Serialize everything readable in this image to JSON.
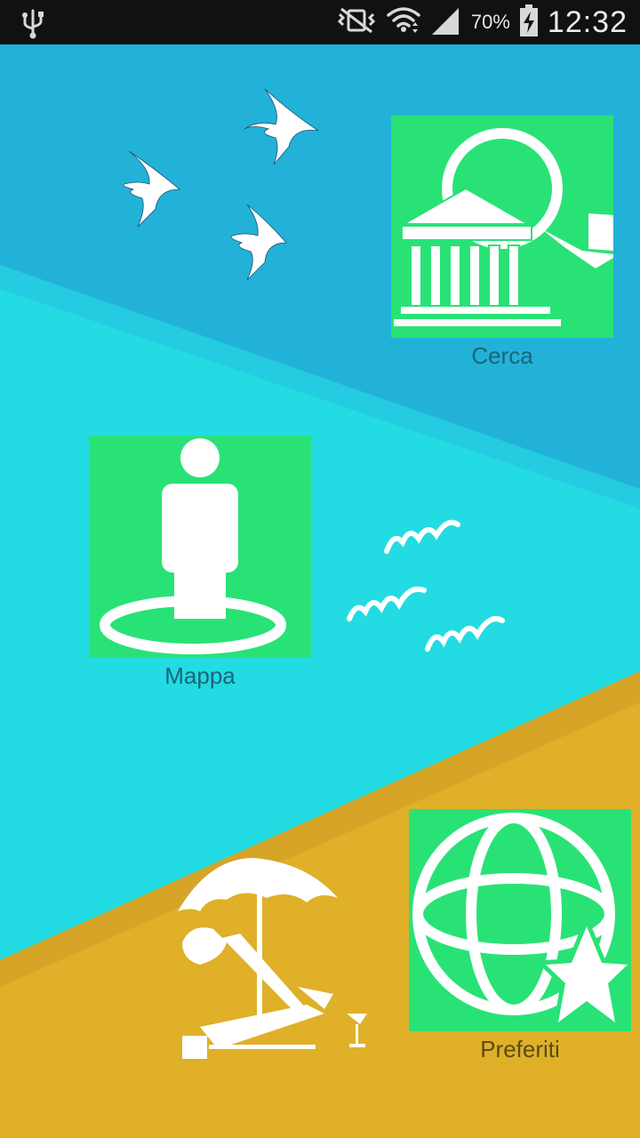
{
  "status_bar": {
    "battery_percent": "70%",
    "time": "12:32",
    "icons": [
      "usb-icon",
      "vibrate-mute-icon",
      "wifi-icon",
      "signal-icon",
      "battery-charging-icon"
    ]
  },
  "colors": {
    "sky": "#22b2d8",
    "sky_band": "#25cbe0",
    "sea": "#23dbe2",
    "sand_band": "#d9a928",
    "sand": "#dfb028",
    "tile": "#29e276",
    "label_dark": "#19657a",
    "label_sand": "#5a4a16"
  },
  "menu": {
    "cerca": {
      "label": "Cerca",
      "icon": "search-museum-icon"
    },
    "mappa": {
      "label": "Mappa",
      "icon": "map-person-icon"
    },
    "preferiti": {
      "label": "Preferiti",
      "icon": "globe-star-icon"
    }
  },
  "decorations": [
    "swallows-icon",
    "waves-icon",
    "beach-chair-icon"
  ]
}
